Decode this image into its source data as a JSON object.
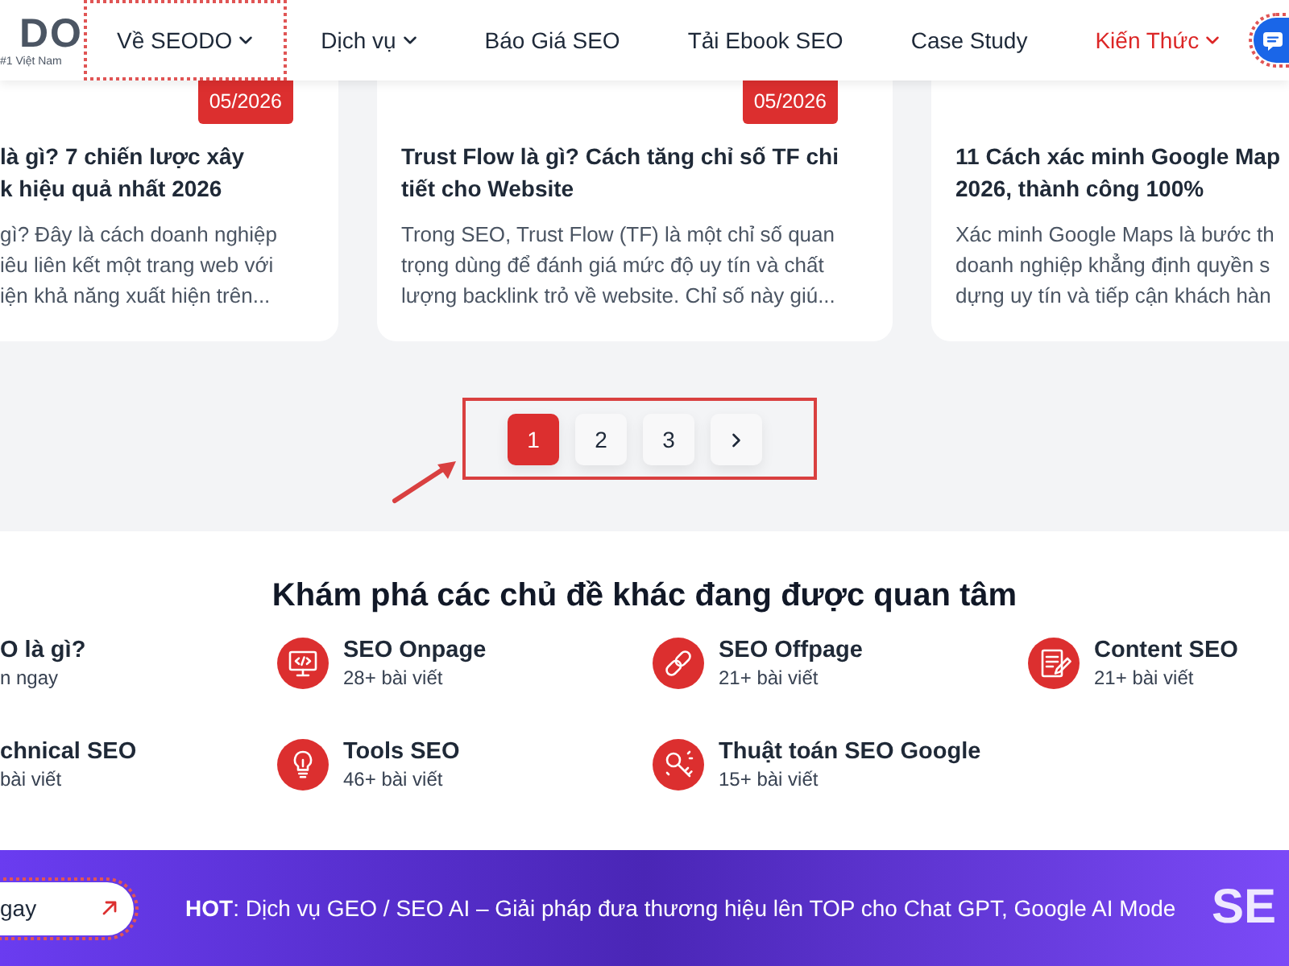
{
  "header": {
    "logo": {
      "text": "DO",
      "tagline": "#1 Việt Nam"
    },
    "nav": [
      {
        "label": "Về SEODO",
        "dropdown": true,
        "selected": false,
        "focused": true
      },
      {
        "label": "Dịch vụ",
        "dropdown": true,
        "selected": false,
        "focused": false
      },
      {
        "label": "Báo Giá SEO",
        "dropdown": false,
        "selected": false,
        "focused": false
      },
      {
        "label": "Tải Ebook SEO",
        "dropdown": false,
        "selected": false,
        "focused": false
      },
      {
        "label": "Case Study",
        "dropdown": false,
        "selected": false,
        "focused": false
      },
      {
        "label": "Kiến Thức",
        "dropdown": true,
        "selected": true,
        "focused": false
      }
    ],
    "chat_button": {
      "focused": true
    }
  },
  "posts": [
    {
      "badge": "05/2026",
      "title_lines": [
        "là gì? 7 chiến lược xây",
        "k hiệu quả nhất 2026"
      ],
      "excerpt_lines": [
        "gì? Đây là cách doanh nghiệp",
        "iêu liên kết một trang web với",
        "iện khả năng xuất hiện trên..."
      ]
    },
    {
      "badge": "05/2026",
      "title_lines": [
        "Trust Flow là gì? Cách tăng chỉ số TF chi",
        "tiết cho Website"
      ],
      "excerpt_lines": [
        "Trong SEO, Trust Flow (TF) là một chỉ số quan",
        "trọng dùng để đánh giá mức độ uy tín và chất",
        "lượng backlink trỏ về website. Chỉ số này giú..."
      ]
    },
    {
      "title_lines": [
        "11 Cách xác minh Google Map",
        "2026, thành công 100%"
      ],
      "excerpt_lines": [
        "Xác minh Google Maps là bước th",
        "doanh nghiệp khẳng định quyền s",
        "dựng uy tín và tiếp cận khách hàn"
      ]
    }
  ],
  "pagination": {
    "pages": [
      {
        "label": "1",
        "selected": true
      },
      {
        "label": "2",
        "selected": false
      },
      {
        "label": "3",
        "selected": false
      }
    ],
    "has_next": true
  },
  "topics": {
    "heading": "Khám phá các chủ đề khác đang được quan tâm",
    "rows": [
      [
        {
          "kind": "partial",
          "title": "O là gì?",
          "caption": "n ngay"
        },
        {
          "kind": "full",
          "title": "SEO Onpage",
          "caption": "28+ bài viết"
        },
        {
          "kind": "full",
          "title": "SEO Offpage",
          "caption": "21+ bài viết"
        },
        {
          "kind": "full",
          "title": "Content SEO",
          "caption": "21+ bài viết"
        }
      ],
      [
        {
          "kind": "partial",
          "title": "chnical SEO",
          "caption": "bài viết"
        },
        {
          "kind": "full",
          "title": "Tools SEO",
          "caption": "46+ bài viết"
        },
        {
          "kind": "full",
          "title": "Thuật toán SEO Google",
          "caption": "15+ bài viết"
        }
      ]
    ]
  },
  "banner": {
    "button": {
      "label": "gay",
      "focused": true
    },
    "text": "**HOT**: Dịch vụ GEO / SEO AI – Giải pháp đưa thương hiệu lên TOP cho Chat GPT, Google AI Mode",
    "logo": "SE"
  }
}
